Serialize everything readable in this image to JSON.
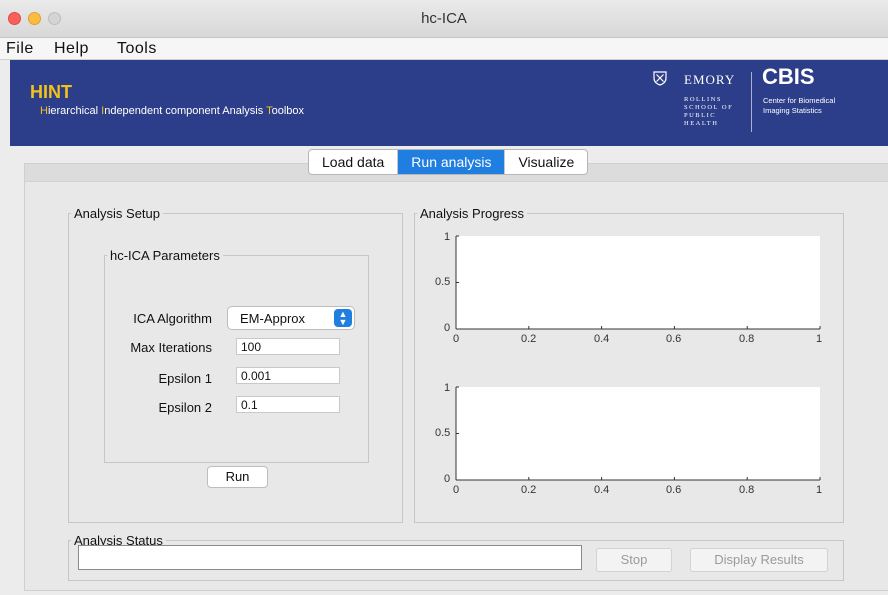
{
  "window": {
    "title": "hc-ICA"
  },
  "menu": {
    "items": [
      "File",
      "Help",
      "Tools"
    ]
  },
  "banner": {
    "app_name": "HINT",
    "subtitle_parts": [
      {
        "text": "H",
        "hl": true
      },
      {
        "text": "ierarchical ",
        "hl": false
      },
      {
        "text": "I",
        "hl": true
      },
      {
        "text": "ndependent component Analysis ",
        "hl": false
      },
      {
        "text": "T",
        "hl": true
      },
      {
        "text": "oolbox",
        "hl": false
      }
    ],
    "emory_word": "EMORY",
    "emory_sub_lines": [
      "ROLLINS",
      "SCHOOL OF",
      "PUBLIC",
      "HEALTH"
    ],
    "cbis_word": "CBIS",
    "cbis_sub_lines": [
      "Center for Biomedical",
      "Imaging Statistics"
    ],
    "accent_color": "#f2c21a",
    "banner_color": "#2c3e8a"
  },
  "tabs": [
    "Load data",
    "Run analysis",
    "Visualize"
  ],
  "active_tab_index": 1,
  "analysis_setup": {
    "legend": "Analysis Setup",
    "params_legend": "hc-ICA Parameters",
    "ica_algorithm_label": "ICA Algorithm",
    "ica_algorithm_value": "EM-Approx",
    "max_iterations_label": "Max Iterations",
    "max_iterations_value": "100",
    "epsilon1_label": "Epsilon 1",
    "epsilon1_value": "0.001",
    "epsilon2_label": "Epsilon 2",
    "epsilon2_value": "0.1",
    "run_label": "Run"
  },
  "analysis_progress": {
    "legend": "Analysis Progress",
    "x_ticks": [
      "0",
      "0.2",
      "0.4",
      "0.6",
      "0.8",
      "1"
    ],
    "y_ticks": [
      "0",
      "0.5",
      "1"
    ]
  },
  "analysis_status": {
    "legend": "Analysis Status",
    "status_text": "",
    "stop_label": "Stop",
    "display_results_label": "Display Results"
  }
}
